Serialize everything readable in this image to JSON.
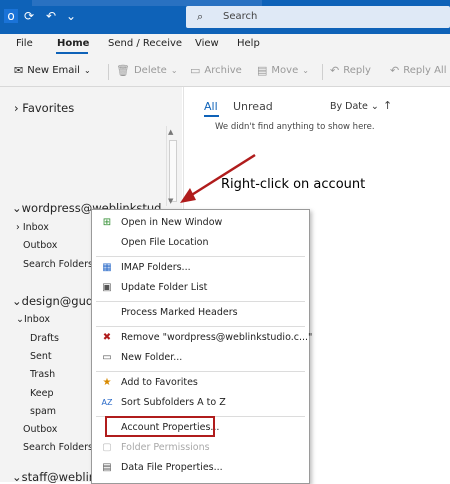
{
  "titlebar": {
    "search_label": "Search",
    "icons": [
      "outlook-logo-icon",
      "sync-icon",
      "undo-icon",
      "dropdown-icon",
      "search-icon"
    ]
  },
  "menu": {
    "items": [
      "File",
      "Home",
      "Send / Receive",
      "View",
      "Help"
    ],
    "active": "Home"
  },
  "toolbar": {
    "new_email": "New Email",
    "delete": "Delete",
    "archive": "Archive",
    "move": "Move",
    "reply": "Reply",
    "reply_all": "Reply All"
  },
  "folders": {
    "favorites": "Favorites",
    "account1": "wordpress@weblinkstud...",
    "account1_folders": [
      "Inbox",
      "Outbox",
      "Search Folders"
    ],
    "account2": "design@gudr",
    "account2_folders": [
      "Inbox",
      "Drafts",
      "Sent",
      "Trash",
      "Keep",
      "spam",
      "Outbox",
      "Search Folders"
    ],
    "account3": "staff@weblink"
  },
  "list": {
    "tab_all": "All",
    "tab_unread": "Unread",
    "sort_by": "By Date",
    "empty_message": "We didn't find anything to show here."
  },
  "annotation": {
    "text": "Right-click on account",
    "color": "#b01c1c"
  },
  "context_menu": {
    "items": [
      {
        "label": "Open in New Window",
        "icon": "new-window-icon",
        "enabled": true
      },
      {
        "label": "Open File Location",
        "icon": "",
        "enabled": true
      },
      {
        "label": "IMAP Folders...",
        "icon": "imap-folders-icon",
        "enabled": true
      },
      {
        "label": "Update Folder List",
        "icon": "update-list-icon",
        "enabled": true
      },
      {
        "label": "Process Marked Headers",
        "icon": "",
        "enabled": true
      },
      {
        "label": "Remove \"wordpress@weblinkstudio.c...\"",
        "icon": "remove-icon",
        "enabled": true
      },
      {
        "label": "New Folder...",
        "icon": "new-folder-icon",
        "enabled": true
      },
      {
        "label": "Add to Favorites",
        "icon": "favorites-icon",
        "enabled": true
      },
      {
        "label": "Sort Subfolders A to Z",
        "icon": "sort-az-icon",
        "enabled": true
      },
      {
        "label": "Account Properties...",
        "icon": "",
        "enabled": true
      },
      {
        "label": "Folder Permissions",
        "icon": "permissions-icon",
        "enabled": false
      },
      {
        "label": "Data File Properties...",
        "icon": "data-file-icon",
        "enabled": true
      }
    ]
  },
  "colors": {
    "titlebar": "#0e62b8",
    "accent": "#0e62b8",
    "highlight": "#b01c1c"
  }
}
